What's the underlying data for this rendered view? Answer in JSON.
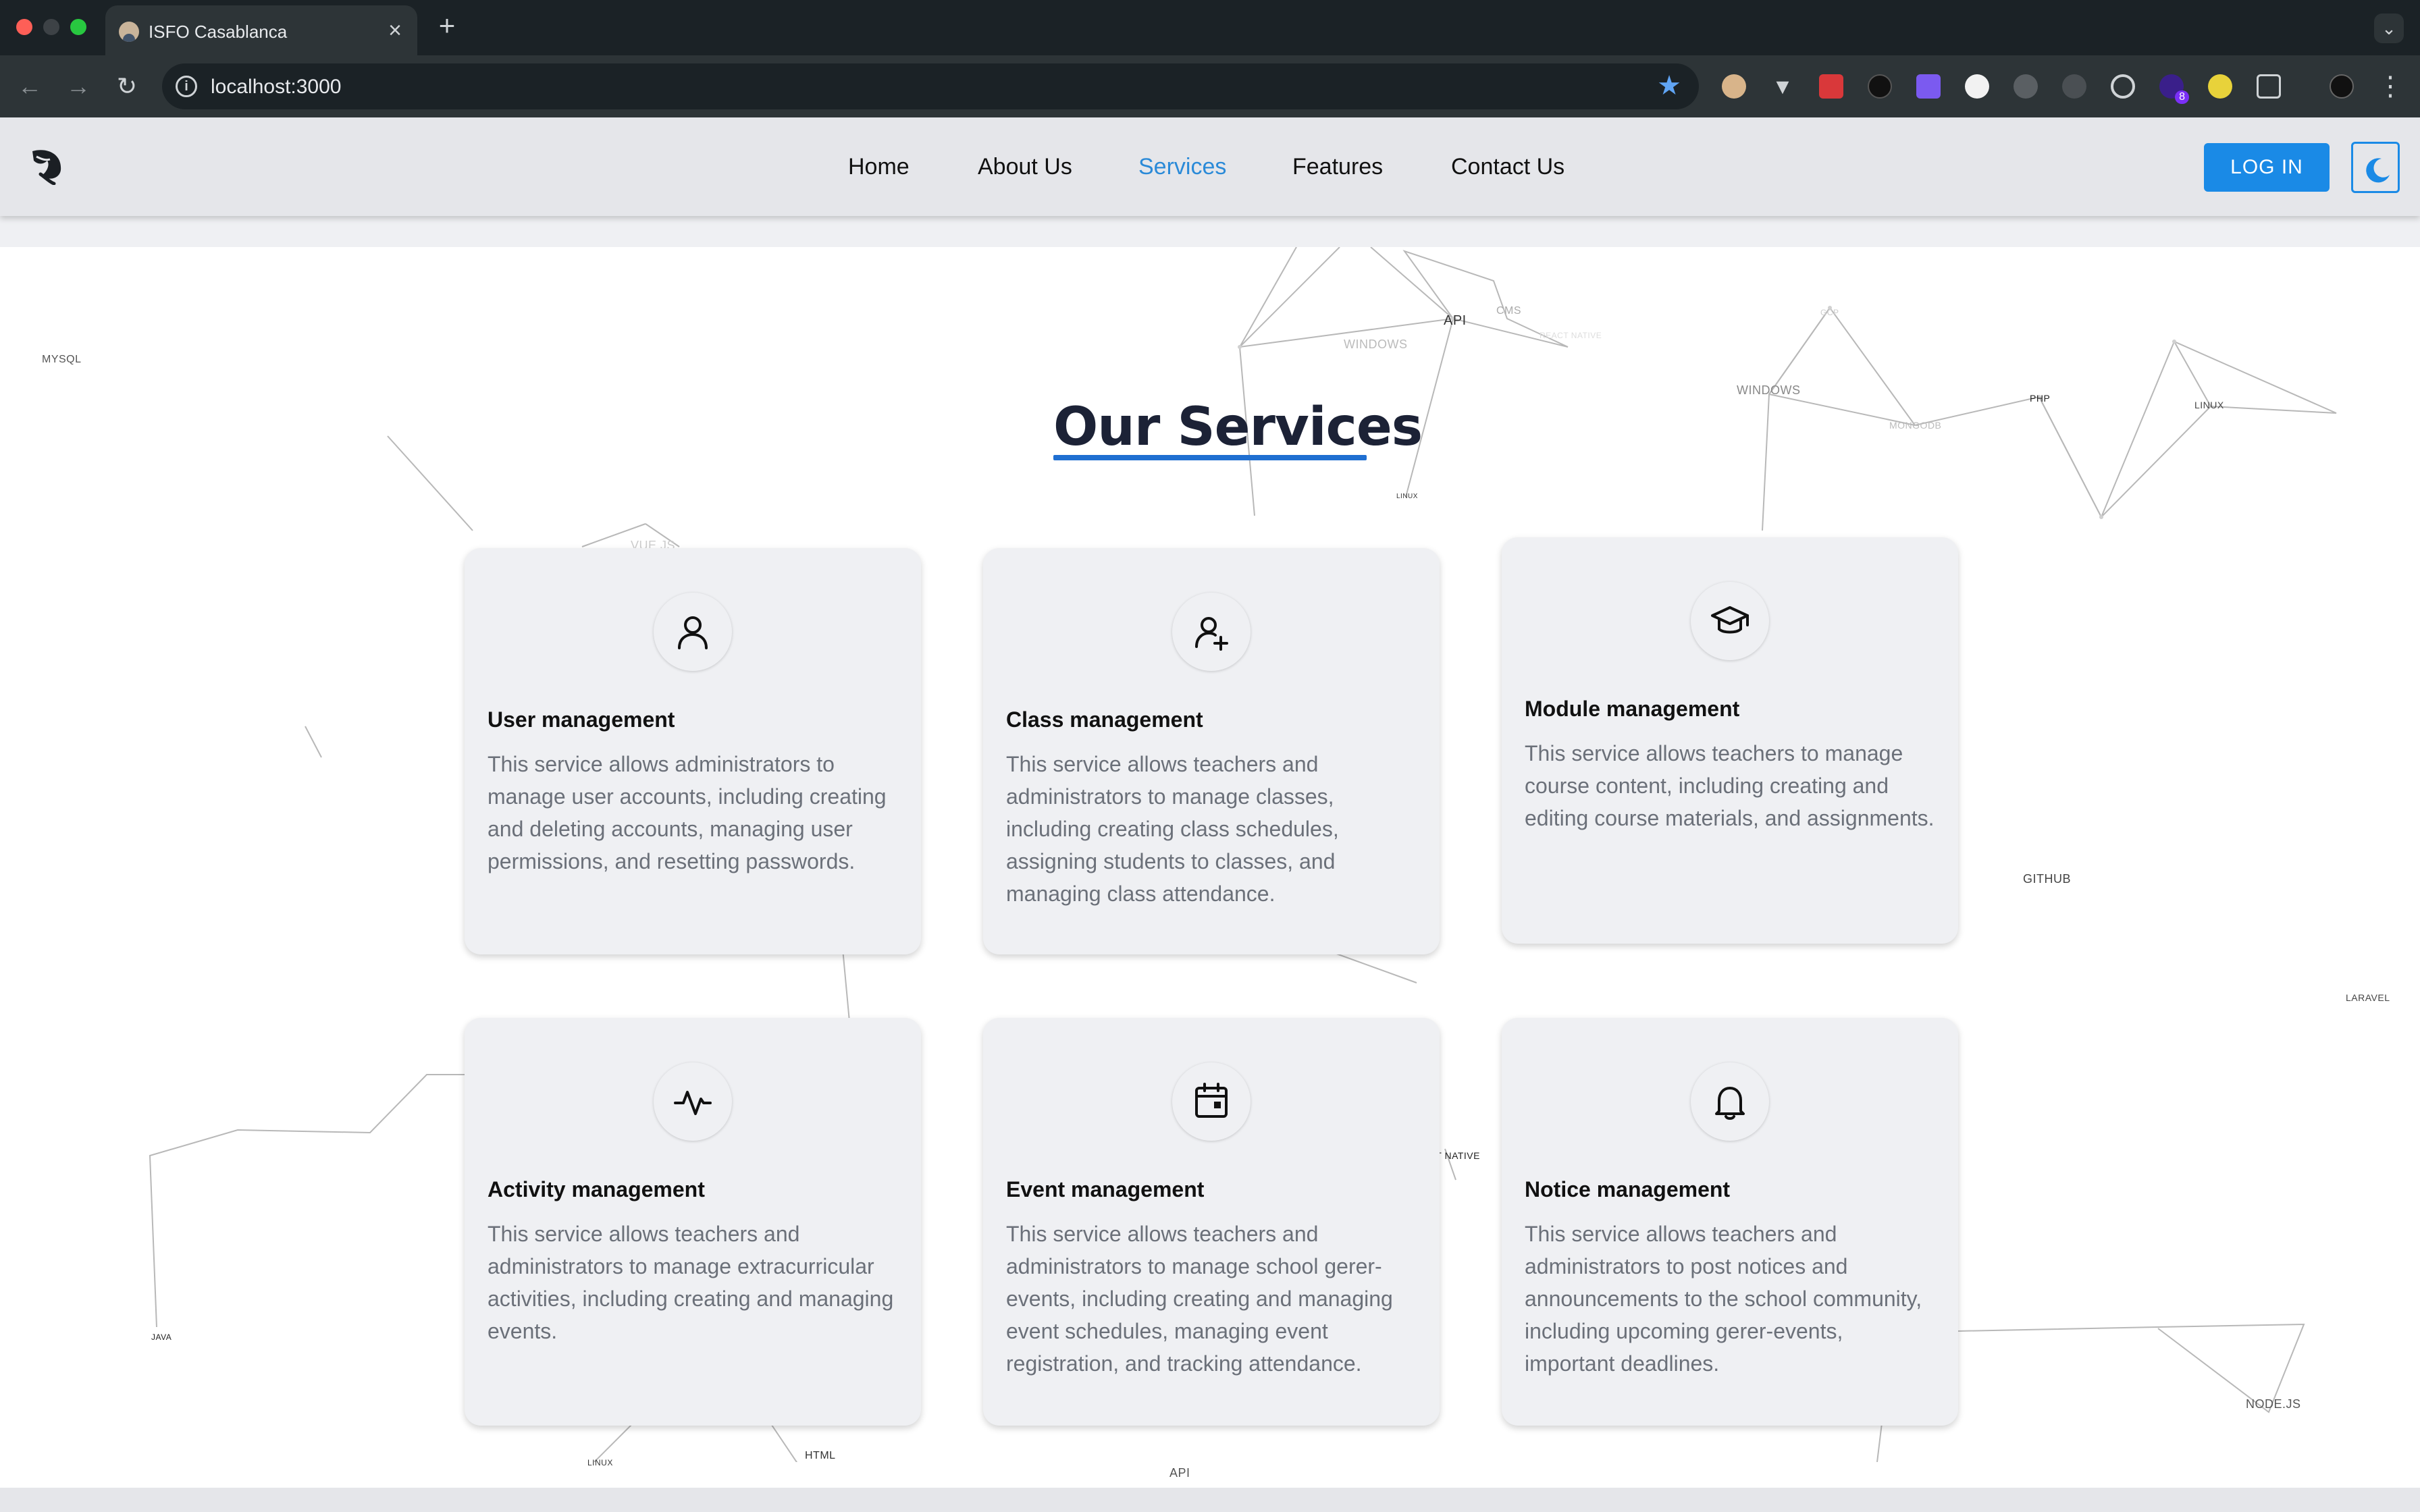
{
  "browser": {
    "tab_title": "ISFO Casablanca",
    "tab_close": "×",
    "new_tab": "+",
    "url": "localhost:3000",
    "extensions_badge": "8"
  },
  "header": {
    "nav": [
      "Home",
      "About Us",
      "Services",
      "Features",
      "Contact Us"
    ],
    "active_nav": "Services",
    "login_label": "LOG IN",
    "accent_color": "#1a8ae6"
  },
  "network_labels": [
    "MYSQL",
    "API",
    "CMS",
    "WINDOWS",
    "REACT NATIVE",
    "GCP",
    "WINDOWS",
    "MONGODB",
    "PHP",
    "LINUX",
    "LINUX",
    "VUE.JS",
    "GITHUB",
    "LARAVEL",
    "REACT NATIVE",
    "JAVA",
    "LINUX",
    "HTML",
    "API",
    "NODE.JS"
  ],
  "services": {
    "heading": "Our Services",
    "cards": [
      {
        "icon": "user-icon",
        "title": "User management",
        "description": "This service allows administrators to manage user accounts, including creating and deleting accounts, managing user permissions, and resetting passwords."
      },
      {
        "icon": "user-add-icon",
        "title": "Class management",
        "description": "This service allows teachers and administrators to manage classes, including creating class schedules, assigning students to classes, and managing class attendance."
      },
      {
        "icon": "graduation-cap-icon",
        "title": "Module management",
        "description": "This service allows teachers to manage course content, including creating and editing course materials, and assignments."
      },
      {
        "icon": "activity-icon",
        "title": "Activity management",
        "description": "This service allows teachers and administrators to manage extracurricular activities, including creating and managing events."
      },
      {
        "icon": "calendar-icon",
        "title": "Event management",
        "description": "This service allows teachers and administrators to manage school gerer-events, including creating and managing event schedules, managing event registration, and tracking attendance."
      },
      {
        "icon": "bell-icon",
        "title": "Notice management",
        "description": "This service allows teachers and administrators to post notices and announcements to the school community, including upcoming gerer-events, important deadlines."
      }
    ]
  }
}
